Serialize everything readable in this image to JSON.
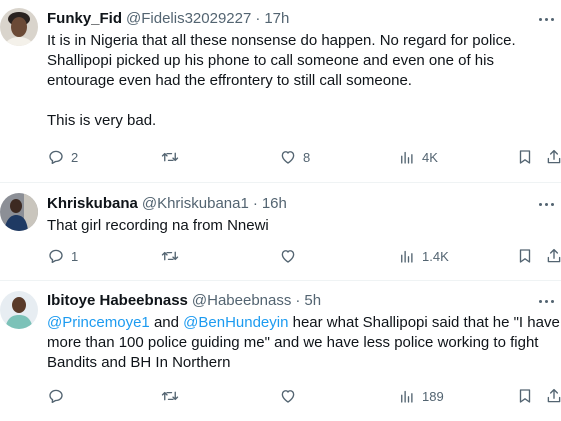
{
  "tweets": [
    {
      "name": "Funky_Fid",
      "handle": "@Fidelis32029227",
      "dot": "·",
      "time": "17h",
      "text": "It is in Nigeria that all these nonsense do happen. No regard for police. Shallipopi picked up his phone to call someone and even one of his entourage even had the effrontery to still call someone.\n\nThis is very bad.",
      "replies": "2",
      "retweets": "",
      "likes": "8",
      "views": "4K"
    },
    {
      "name": "Khriskubana",
      "handle": "@Khriskubana1",
      "dot": "·",
      "time": "16h",
      "text": "That girl recording na from Nnewi",
      "replies": "1",
      "retweets": "",
      "likes": "",
      "views": "1.4K"
    },
    {
      "name": "Ibitoye Habeebnass",
      "handle": "@Habeebnass",
      "dot": "·",
      "time": "5h",
      "mention1": "@Princemoye1",
      "and": " and ",
      "mention2": "@BenHundeyin",
      "text": " hear what Shallipopi said that he \"I have more than 100 police guiding me\" and we have less police working to fight Bandits and BH In Northern",
      "replies": "",
      "retweets": "",
      "likes": "",
      "views": "189"
    }
  ],
  "icons": {
    "reply": "reply-icon",
    "retweet": "retweet-icon",
    "like": "heart-icon",
    "views": "views-icon",
    "bookmark": "bookmark-icon",
    "share": "share-icon",
    "more": "more-icon"
  },
  "colors": {
    "text": "#0f1419",
    "secondary": "#536471",
    "link": "#1d9bf0",
    "divider": "#eff3f4"
  }
}
